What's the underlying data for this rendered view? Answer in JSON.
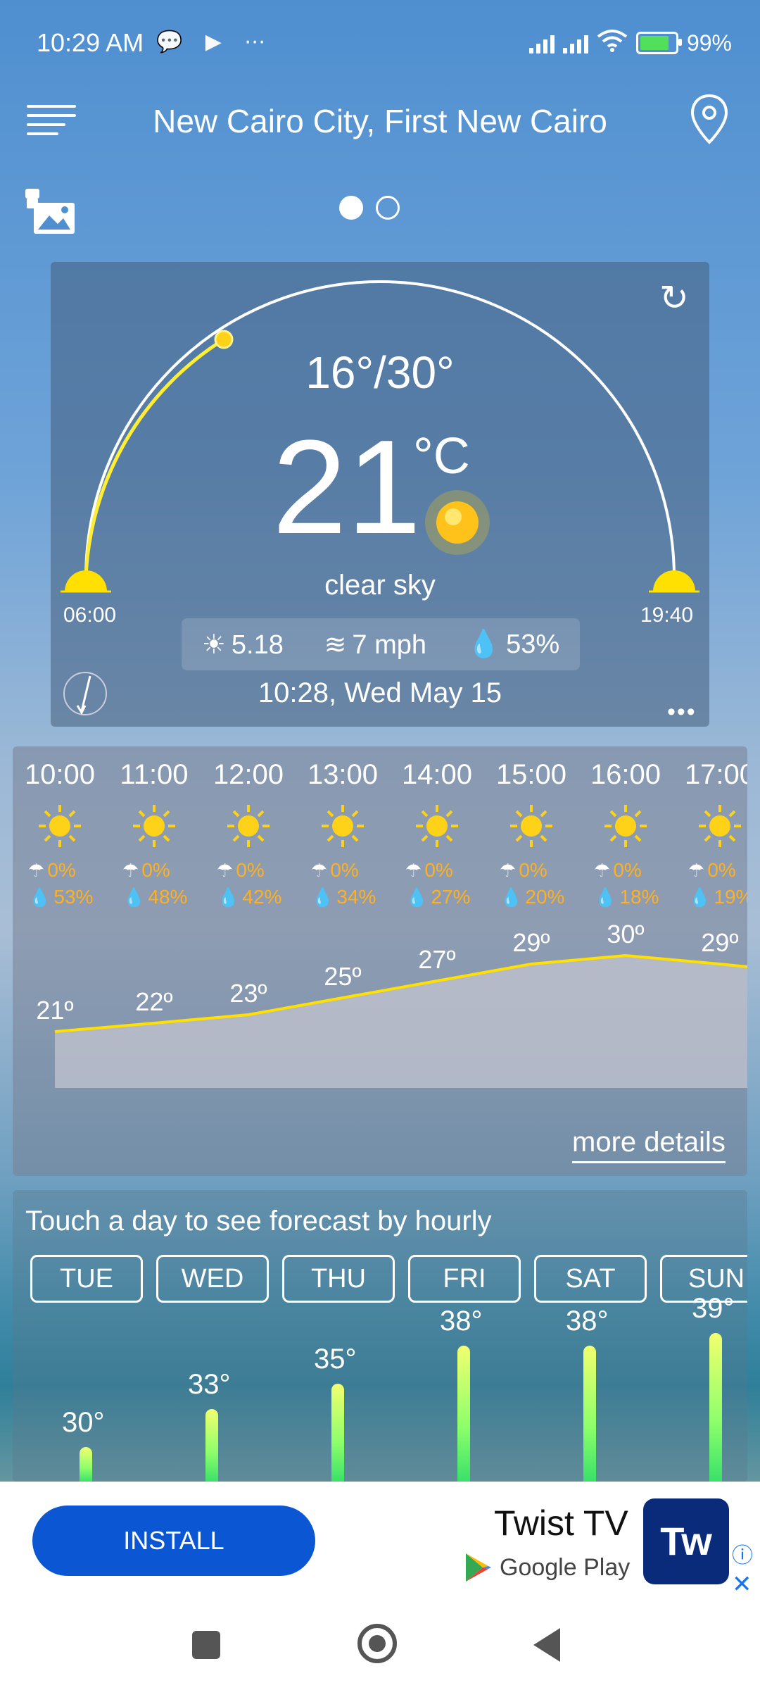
{
  "status_bar": {
    "time": "10:29 AM",
    "icons": "⋯",
    "battery": "99%"
  },
  "header": {
    "location": "New Cairo City, First New Cairo"
  },
  "current": {
    "range": "16°/30°",
    "temp": "21",
    "unit": "°C",
    "description": "clear sky",
    "sunrise": "06:00",
    "sunset": "19:40",
    "uv": "5.18",
    "wind": "7 mph",
    "humidity": "53%",
    "datetime": "10:28, Wed May 15",
    "more": "•••"
  },
  "hourly": [
    {
      "time": "10:00",
      "rain": "0%",
      "hum": "53%",
      "temp": "21º"
    },
    {
      "time": "11:00",
      "rain": "0%",
      "hum": "48%",
      "temp": "22º"
    },
    {
      "time": "12:00",
      "rain": "0%",
      "hum": "42%",
      "temp": "23º"
    },
    {
      "time": "13:00",
      "rain": "0%",
      "hum": "34%",
      "temp": "25º"
    },
    {
      "time": "14:00",
      "rain": "0%",
      "hum": "27%",
      "temp": "27º"
    },
    {
      "time": "15:00",
      "rain": "0%",
      "hum": "20%",
      "temp": "29º"
    },
    {
      "time": "16:00",
      "rain": "0%",
      "hum": "18%",
      "temp": "30º"
    },
    {
      "time": "17:00",
      "rain": "0%",
      "hum": "19%",
      "temp": "29º"
    }
  ],
  "more_details": "more details",
  "daily": {
    "hint": "Touch a day to see forecast by hourly",
    "days": [
      "TUE",
      "WED",
      "THU",
      "FRI",
      "SAT",
      "SUN"
    ],
    "temps": [
      "30°",
      "33°",
      "35°",
      "38°",
      "38°",
      "39°"
    ]
  },
  "ad": {
    "install": "INSTALL",
    "app": "Twist TV",
    "store": "Google Play",
    "logo": "Tw",
    "info": "ⓘ",
    "close": "✕"
  },
  "colors": {
    "sun_path": "#ffee33",
    "accent": "#ffb020",
    "install": "#0b56d3"
  }
}
